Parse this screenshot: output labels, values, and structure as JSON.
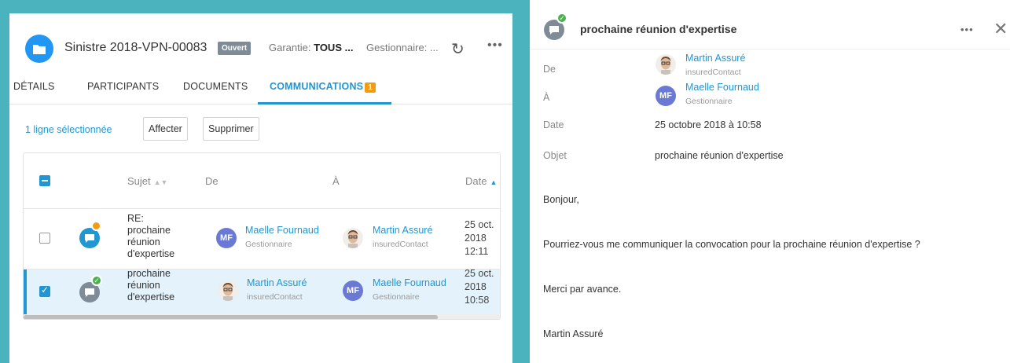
{
  "header": {
    "claim_title": "Sinistre 2018-VPN-00083",
    "status_badge": "Ouvert",
    "garantie_label": "Garantie:",
    "garantie_value": "TOUS ...",
    "gestionnaire_label": "Gestionnaire: ...",
    "refresh_icon": "↻",
    "more_icon": "•••"
  },
  "tabs": [
    {
      "label": "DÉTAILS"
    },
    {
      "label": "PARTICIPANTS"
    },
    {
      "label": "DOCUMENTS"
    },
    {
      "label": "COMMUNICATIONS",
      "count": "1"
    }
  ],
  "selection": {
    "text": "1 ligne sélectionnée",
    "assign_label": "Affecter",
    "delete_label": "Supprimer"
  },
  "table": {
    "headers": {
      "subject": "Sujet",
      "from": "De",
      "to": "À",
      "date": "Date"
    },
    "rows": [
      {
        "subject_lines": [
          "RE:",
          "prochaine",
          "réunion",
          "d'expertise"
        ],
        "from": {
          "initials": "MF",
          "name": "Maelle Fournaud",
          "role": "Gestionnaire"
        },
        "to": {
          "name": "Martin Assuré",
          "role": "insuredContact"
        },
        "date_lines": [
          "25 oct.",
          "2018",
          "12:11"
        ]
      },
      {
        "subject_lines": [
          "prochaine",
          "réunion",
          "d'expertise"
        ],
        "from": {
          "name": "Martin Assuré",
          "role": "insuredContact"
        },
        "to": {
          "initials": "MF",
          "name": "Maelle Fournaud",
          "role": "Gestionnaire"
        },
        "date_lines": [
          "25 oct.",
          "2018",
          "10:58"
        ]
      }
    ]
  },
  "detail": {
    "title": "prochaine réunion d'expertise",
    "more_icon": "•••",
    "close_icon": "✕",
    "fields": {
      "from_label": "De",
      "from_name": "Martin Assuré",
      "from_role": "insuredContact",
      "to_label": "À",
      "to_initials": "MF",
      "to_name": "Maelle Fournaud",
      "to_role": "Gestionnaire",
      "date_label": "Date",
      "date_value": "25 octobre 2018 à 10:58",
      "object_label": "Objet",
      "object_value": "prochaine réunion d'expertise"
    },
    "body": [
      "Bonjour,",
      "Pourriez-vous me communiquer la convocation pour la prochaine réunion d'expertise ?",
      "Merci par avance.",
      "Martin Assuré"
    ]
  },
  "colors": {
    "accent": "#2196d3",
    "teal_bg": "#4ab3bd",
    "orange": "#f39c12",
    "green": "#4caf50",
    "avatar_mf": "#6a7ad4"
  }
}
